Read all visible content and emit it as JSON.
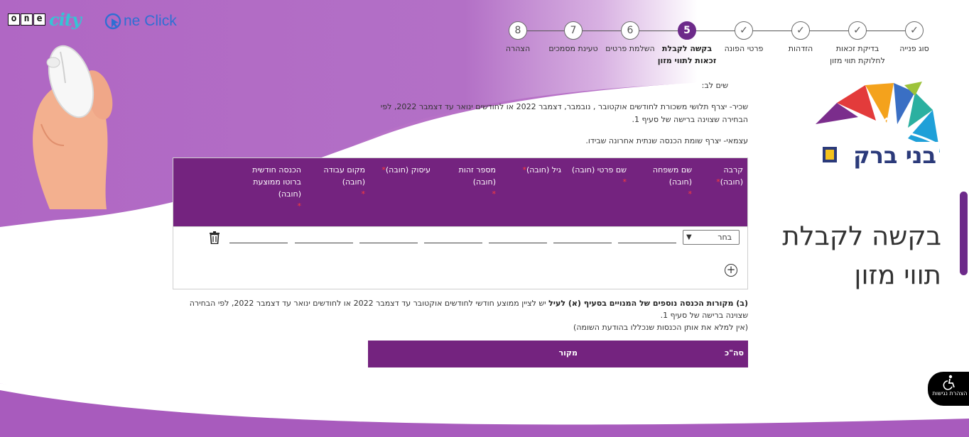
{
  "brand": {
    "onecity_letters": [
      "o",
      "n",
      "e"
    ],
    "onecity_suffix": "city",
    "oneclick_text": "ne Click",
    "city_logo_text": "בני ברק"
  },
  "stepper": {
    "steps": [
      {
        "number": "8",
        "label": "הצהרה",
        "state": "todo"
      },
      {
        "number": "7",
        "label": "טעינת מסמכים",
        "state": "todo"
      },
      {
        "number": "6",
        "label": "השלמת פרטים",
        "state": "todo"
      },
      {
        "number": "5",
        "label": "בקשה לקבלת זכאות לתווי מזון",
        "state": "active"
      },
      {
        "number": "✓",
        "label": "פרטי הפונה",
        "state": "done"
      },
      {
        "number": "✓",
        "label": "הזדהות",
        "state": "done"
      },
      {
        "number": "✓",
        "label": "בדיקת זכאות לחלוקת תווי מזון",
        "state": "done"
      },
      {
        "number": "✓",
        "label": "סוג פנייה",
        "state": "done"
      }
    ]
  },
  "page": {
    "title_line1": "בקשה לקבלת",
    "title_line2": "תווי מזון"
  },
  "notes": {
    "title": "שים לב:",
    "salaried": "שכיר- יצרף תלושי משכורת לחודשים אוקטובר , נובמבר, דצמבר 2022 או לחודשים ינואר עד דצמבר 2022, לפי הבחירה שצוינה ברישה של סעיף 1.",
    "self_employed": "עצמאי- יצרף שומת הכנסה שנתית אחרונה שבידו."
  },
  "table1": {
    "headers": [
      "קרבה (חובה)",
      "שם משפחה (חובה)",
      "שם פרטי (חובה)",
      "גיל (חובה)",
      "מספר זהות (חובה)",
      "עיסוק (חובה)",
      "מקום עבודה (חובה)",
      "הכנסה חודשית ברוטו ממוצעת (חובה)"
    ],
    "select_value": "בחר",
    "required_mark": "*"
  },
  "section_b": {
    "bold": "(ב) מקורות הכנסה נוספים של המנויים בסעיף (א) לעיל",
    "text": " יש לציין ממוצע חודשי לחודשים  אוקטובר עד דצמבר 2022 או לחודשים ינואר עד דצמבר 2022, לפי הבחירה שצוינה ברישה של סעיף  1.",
    "note": "(אין למלא את אותן הכנסות שנכללו בהודעת השומה)"
  },
  "table2": {
    "headers": [
      "סה\"כ",
      "מקור"
    ]
  },
  "accessibility": {
    "label": "הצהרת נגישות"
  },
  "colors": {
    "purple": "#74237f",
    "accent": "#6d2a8a"
  }
}
